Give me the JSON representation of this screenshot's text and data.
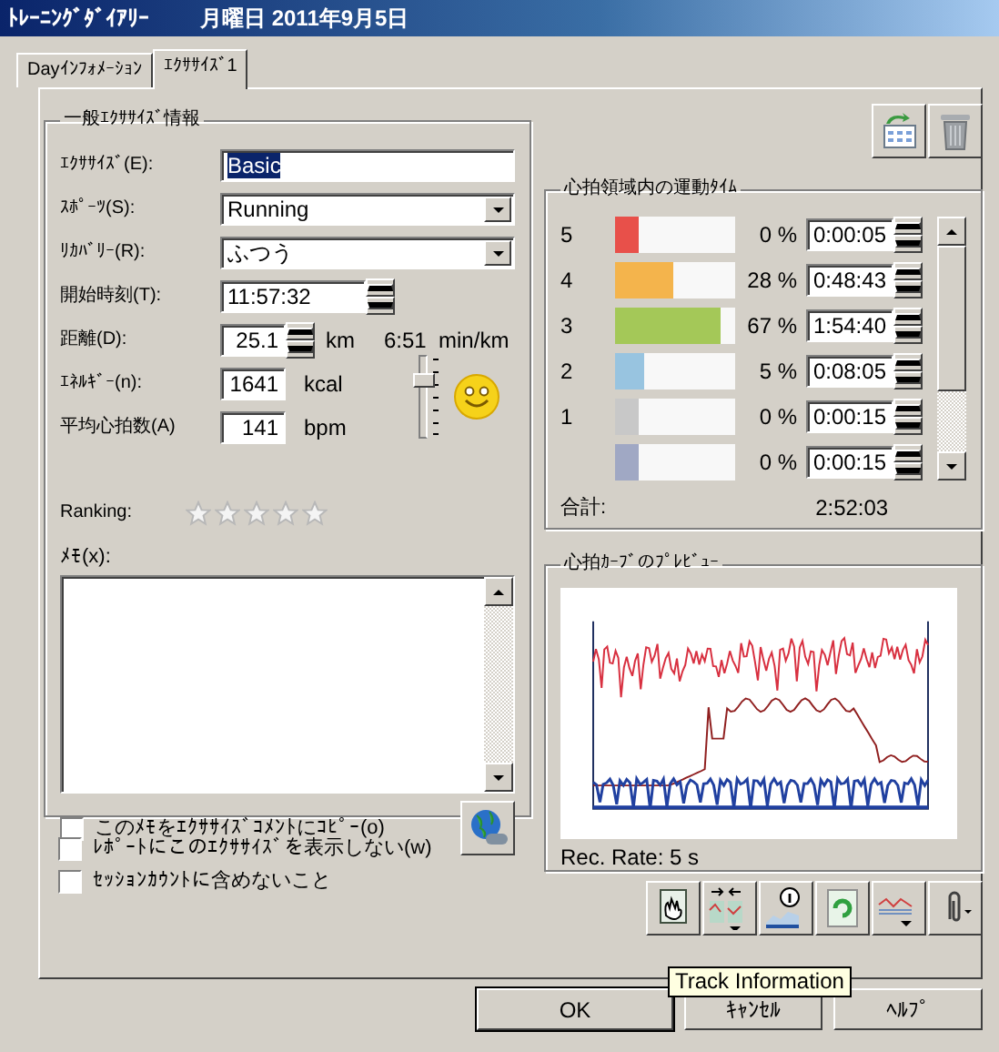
{
  "window": {
    "title": "ﾄﾚｰﾆﾝｸﾞﾀﾞｲｱﾘｰ",
    "date": "月曜日 2011年9月5日"
  },
  "tabs": [
    {
      "label": "Dayｲﾝﾌｫﾒｰｼｮﾝ",
      "selected": false
    },
    {
      "label": "ｴｸｻｻｲｽﾞ1",
      "selected": true
    }
  ],
  "general": {
    "title": "一般ｴｸｻｻｲｽﾞ情報",
    "fields": [
      {
        "kind": "text",
        "label": "ｴｸｻｻｲｽﾞ(E):",
        "value": "Basic",
        "text_selected": true
      },
      {
        "kind": "dropdown",
        "label": "ｽﾎﾟｰﾂ(S):",
        "value": "Running"
      },
      {
        "kind": "dropdown",
        "label": "ﾘｶﾊﾞﾘｰ(R):",
        "value": "ふつう"
      },
      {
        "kind": "spinner",
        "label": "開始時刻(T):",
        "value": "11:57:32"
      },
      {
        "kind": "spinner",
        "label": "距離(D):",
        "value": "25.1",
        "unit": "km",
        "extra": "6:51  min/km"
      },
      {
        "kind": "number",
        "label": "ｴﾈﾙｷﾞｰ(n):",
        "value": "1641",
        "unit": "kcal"
      },
      {
        "kind": "number",
        "label": "平均心拍数(A)",
        "value": "141",
        "unit": "bpm"
      }
    ],
    "feeling": {
      "level": 0.75
    },
    "ranking": {
      "label": "Ranking:",
      "stars": 0
    },
    "memo": {
      "label": "ﾒﾓ(x):"
    },
    "copy_memo": {
      "label": "このﾒﾓをｴｸｻｻｲｽﾞｺﾒﾝﾄにｺﾋﾟｰ(o)",
      "checked": false
    }
  },
  "options": [
    {
      "label": "ﾚﾎﾟｰﾄにこのｴｸｻｻｲｽﾞを表示しない(w)",
      "checked": false
    },
    {
      "label": "ｾｯｼｮﾝｶｳﾝﾄに含めないこと",
      "checked": false
    }
  ],
  "zones": {
    "title": "心拍領域内の運動ﾀｲﾑ",
    "rows": [
      {
        "zone": "5",
        "color": "#e8504a",
        "level": 0.19,
        "percent": "0 %",
        "time": "0:00:05"
      },
      {
        "zone": "4",
        "color": "#f4b44c",
        "level": 0.49,
        "percent": "28 %",
        "time": "0:48:43"
      },
      {
        "zone": "3",
        "color": "#a4c858",
        "level": 0.88,
        "percent": "67 %",
        "time": "1:54:40"
      },
      {
        "zone": "2",
        "color": "#98c4e0",
        "level": 0.24,
        "percent": "5 %",
        "time": "0:08:05"
      },
      {
        "zone": "1",
        "color": "#c8c8c8",
        "level": 0.19,
        "percent": "0 %",
        "time": "0:00:15"
      },
      {
        "color": "#a0a8c4",
        "level": 0.19,
        "percent": "0 %",
        "time": "0:00:15"
      }
    ],
    "total_label": "合計:",
    "total": "2:52:03"
  },
  "preview": {
    "title": "心拍ｶｰﾌﾞのﾌﾟﾚﾋﾞｭｰ",
    "rate": "Rec. Rate: 5 s"
  },
  "tooltip": "Track Information",
  "buttons": [
    {
      "label": "OK",
      "default": true
    },
    {
      "label": "ｷｬﾝｾﾙ",
      "default": false
    },
    {
      "label": "ﾍﾙﾌﾟ",
      "default": false
    }
  ]
}
